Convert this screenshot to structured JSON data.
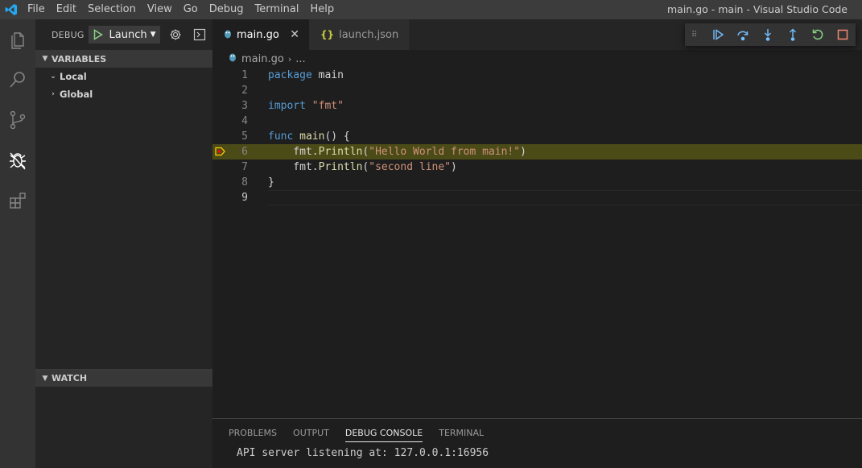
{
  "window": {
    "title": "main.go - main - Visual Studio Code",
    "menu": [
      "File",
      "Edit",
      "Selection",
      "View",
      "Go",
      "Debug",
      "Terminal",
      "Help"
    ]
  },
  "activity": [
    "explorer-icon",
    "search-icon",
    "source-control-icon",
    "debug-icon",
    "extensions-icon"
  ],
  "sidebar": {
    "debug_label": "DEBUG",
    "config_name": "Launch",
    "variables_header": "VARIABLES",
    "scopes": [
      "Local",
      "Global"
    ],
    "watch_header": "WATCH"
  },
  "tabs": [
    {
      "label": "main.go",
      "icon": "go-file-icon"
    },
    {
      "label": "launch.json",
      "icon": "json-file-icon"
    }
  ],
  "breadcrumb": {
    "file": "main.go",
    "rest": "..."
  },
  "code": {
    "line_numbers": [
      "1",
      "2",
      "3",
      "4",
      "5",
      "6",
      "7",
      "8",
      "9"
    ],
    "l1_kw": "package",
    "l1_rest": " main",
    "l3_kw": "import",
    "l3_str": "\"fmt\"",
    "l5_kw": "func",
    "l5_fn": "main",
    "l5_rest": "() {",
    "l6_a": "    fmt.",
    "l6_fn": "Println",
    "l6_b": "(",
    "l6_str": "\"Hello World from main!\"",
    "l6_c": ")",
    "l7_a": "    fmt.",
    "l7_fn": "Println",
    "l7_b": "(",
    "l7_str": "\"second line\"",
    "l7_c": ")",
    "l8": "}",
    "paused_line": 6
  },
  "debug_toolbar": [
    "continue-icon",
    "step-over-icon",
    "step-into-icon",
    "step-out-icon",
    "restart-icon",
    "stop-icon"
  ],
  "panel": {
    "tabs": [
      "PROBLEMS",
      "OUTPUT",
      "DEBUG CONSOLE",
      "TERMINAL"
    ],
    "active_tab": "DEBUG CONSOLE",
    "console_output": "API server listening at: 127.0.0.1:16956"
  },
  "colors": {
    "accent_blue": "#75beff",
    "paused_highlight": "#4b4b18",
    "breakpoint_yellow": "#ffcc00",
    "stop_red": "#f48771",
    "restart_green": "#89d185"
  }
}
